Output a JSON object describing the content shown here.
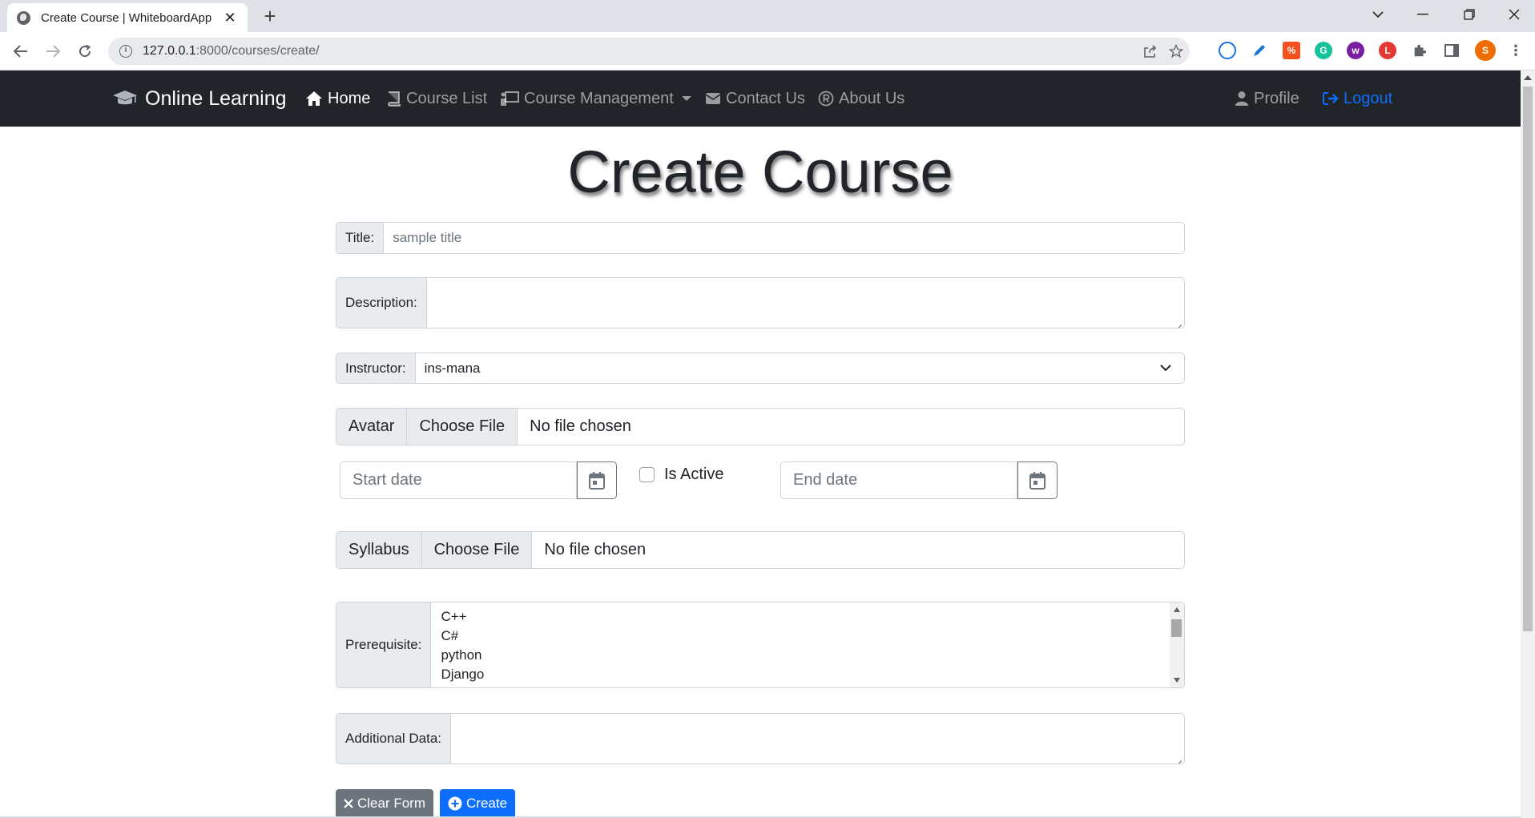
{
  "browser": {
    "tab_title": "Create Course | WhiteboardApp",
    "url_host": "127.0.0.1",
    "url_rest": ":8000/courses/create/",
    "profile_initial": "S"
  },
  "navbar": {
    "brand": "Online Learning",
    "items": [
      {
        "label": "Home",
        "icon": "home-icon"
      },
      {
        "label": "Course List",
        "icon": "book-icon"
      },
      {
        "label": "Course Management",
        "icon": "chalkboard-icon"
      },
      {
        "label": "Contact Us",
        "icon": "envelope-icon"
      },
      {
        "label": "About Us",
        "icon": "registered-icon"
      }
    ],
    "profile": "Profile",
    "logout": "Logout",
    "colors": {
      "background": "#212529",
      "active": "#ffffff",
      "muted": "rgba(255,255,255,0.55)",
      "logout": "#0d6efd"
    }
  },
  "page": {
    "title": "Create Course"
  },
  "form": {
    "title_label": "Title:",
    "title_placeholder": "sample title",
    "description_label": "Description:",
    "instructor_label": "Instructor:",
    "instructor_value": "ins-mana",
    "avatar_label": "Avatar",
    "choose_file": "Choose File",
    "no_file": "No file chosen",
    "start_date_placeholder": "Start date",
    "is_active_label": "Is Active",
    "end_date_placeholder": "End date",
    "syllabus_label": "Syllabus",
    "prerequisite_label": "Prerequisite:",
    "prerequisite_options": [
      "C++",
      "C#",
      "python",
      "Django"
    ],
    "additional_label": "Additional Data:",
    "clear_button": "Clear Form",
    "create_button": "Create",
    "colors": {
      "primary": "#0d6efd",
      "secondary": "#6c757d",
      "label_bg": "#e9ecef",
      "border": "#ced4da"
    }
  }
}
